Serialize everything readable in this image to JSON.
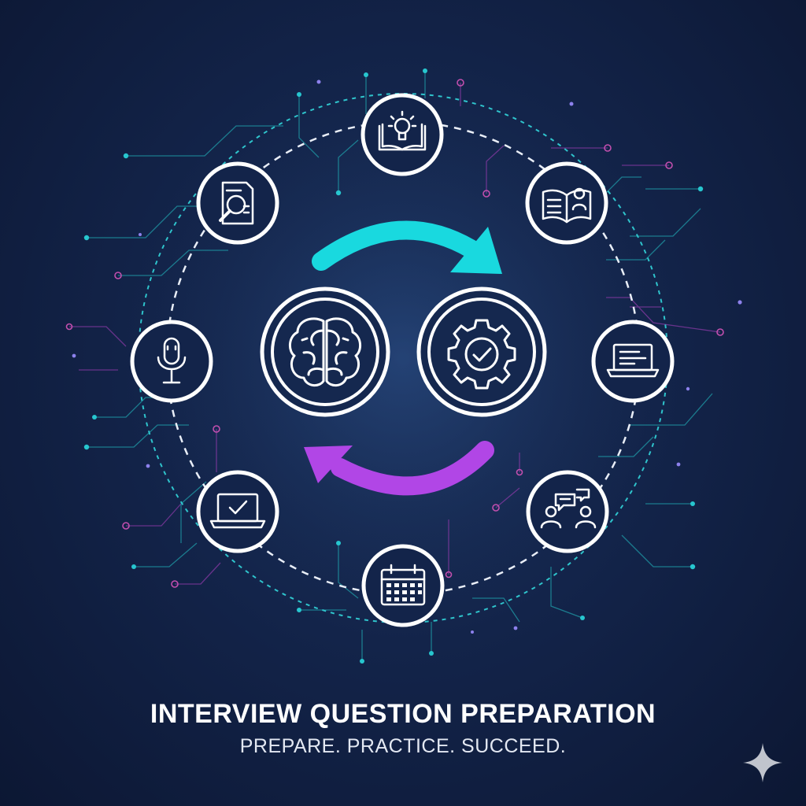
{
  "title": "INTERVIEW QUESTION PREPARATION",
  "tagline": "PREPARE. PRACTICE. SUCCEED.",
  "colors": {
    "background": "#13244a",
    "teal": "#19d9df",
    "magenta": "#b146e6",
    "white": "#ffffff"
  },
  "cycle": {
    "center_icons": [
      "brain-icon",
      "gear-check-icon"
    ],
    "arrows": [
      "teal-arrow",
      "magenta-arrow"
    ]
  },
  "nodes": [
    {
      "id": "idea-book",
      "icon": "lightbulb-book-icon"
    },
    {
      "id": "open-book",
      "icon": "open-book-icon"
    },
    {
      "id": "laptop-document",
      "icon": "laptop-document-icon"
    },
    {
      "id": "discussion",
      "icon": "people-chat-icon"
    },
    {
      "id": "calendar",
      "icon": "calendar-icon"
    },
    {
      "id": "laptop-check",
      "icon": "laptop-check-icon"
    },
    {
      "id": "microphone",
      "icon": "microphone-icon"
    },
    {
      "id": "research",
      "icon": "document-search-icon"
    }
  ]
}
